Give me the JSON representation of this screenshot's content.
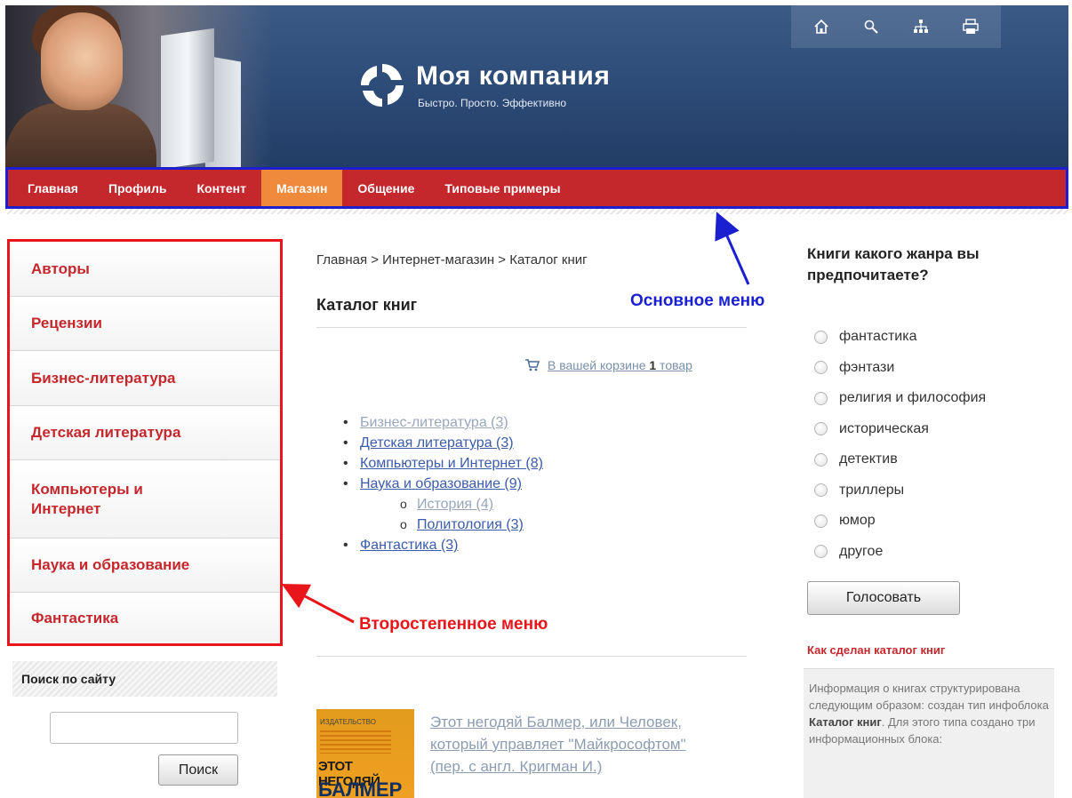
{
  "header": {
    "brand_title": "Моя компания",
    "brand_subtitle": "Быстро. Просто. Эффективно",
    "tools": [
      "home-icon",
      "search-icon",
      "sitemap-icon",
      "print-icon"
    ]
  },
  "main_menu": {
    "items": [
      {
        "label": "Главная",
        "active": false
      },
      {
        "label": "Профиль",
        "active": false
      },
      {
        "label": "Контент",
        "active": false
      },
      {
        "label": "Магазин",
        "active": true
      },
      {
        "label": "Общение",
        "active": false
      },
      {
        "label": "Типовые примеры",
        "active": false
      }
    ]
  },
  "sub_menu": {
    "items": [
      {
        "label": "Авторы"
      },
      {
        "label": "Рецензии"
      },
      {
        "label": "Бизнес-литература"
      },
      {
        "label": "Детская литература"
      },
      {
        "label": "Компьютеры и Интернет"
      },
      {
        "label": "Наука и образование"
      },
      {
        "label": "Фантастика"
      }
    ]
  },
  "search": {
    "title": "Поиск по сайту",
    "value": "",
    "button_label": "Поиск"
  },
  "content": {
    "breadcrumb": "Главная > Интернет-магазин > Каталог книг",
    "title": "Каталог книг",
    "cart_prefix": "В вашей корзине ",
    "cart_count": "1",
    "cart_suffix": " товар",
    "categories": [
      {
        "label": "Бизнес-литература (3)",
        "level": 1,
        "visited": true
      },
      {
        "label": "Детская литература (3)",
        "level": 1,
        "visited": false
      },
      {
        "label": "Компьютеры и Интернет (8)",
        "level": 1,
        "visited": false
      },
      {
        "label": "Наука и образование (9)",
        "level": 1,
        "visited": false
      },
      {
        "label": "История (4)",
        "level": 2,
        "visited": true
      },
      {
        "label": "Политология (3)",
        "level": 2,
        "visited": false
      },
      {
        "label": "Фантастика (3)",
        "level": 1,
        "visited": false
      }
    ],
    "book": {
      "cover_text_small": "ИЗДАТЕЛЬСТВО",
      "cover_title_1": "ЭТОТ НЕГОДЯЙ",
      "cover_title_2": "БАЛМЕР",
      "link": "Этот негодяй Балмер, или Человек, который управляет \"Майкрософтом\" (пер. с англ. Кригман И.)"
    }
  },
  "poll": {
    "question": "Книги какого жанра вы предпочитаете?",
    "options": [
      "фантастика",
      "фэнтази",
      "религия и философия",
      "историческая",
      "детектив",
      "триллеры",
      "юмор",
      "другое"
    ],
    "vote_label": "Голосовать"
  },
  "howto": {
    "title": "Как сделан каталог книг",
    "text_1": "Информация о книгах структурирована следующим образом: создан тип инфоблока ",
    "text_bold": "Каталог книг",
    "text_2": ". Для этого типа создано три информационных блока:"
  },
  "annotations": {
    "main_menu": "Основное меню",
    "sub_menu": "Второстепенное меню"
  },
  "colors": {
    "menu_red": "#c4272c",
    "menu_active": "#ef8a3d",
    "annotation_blue": "#1a1fd0",
    "annotation_red": "#e8161b",
    "link_blue": "#3b5bab"
  }
}
